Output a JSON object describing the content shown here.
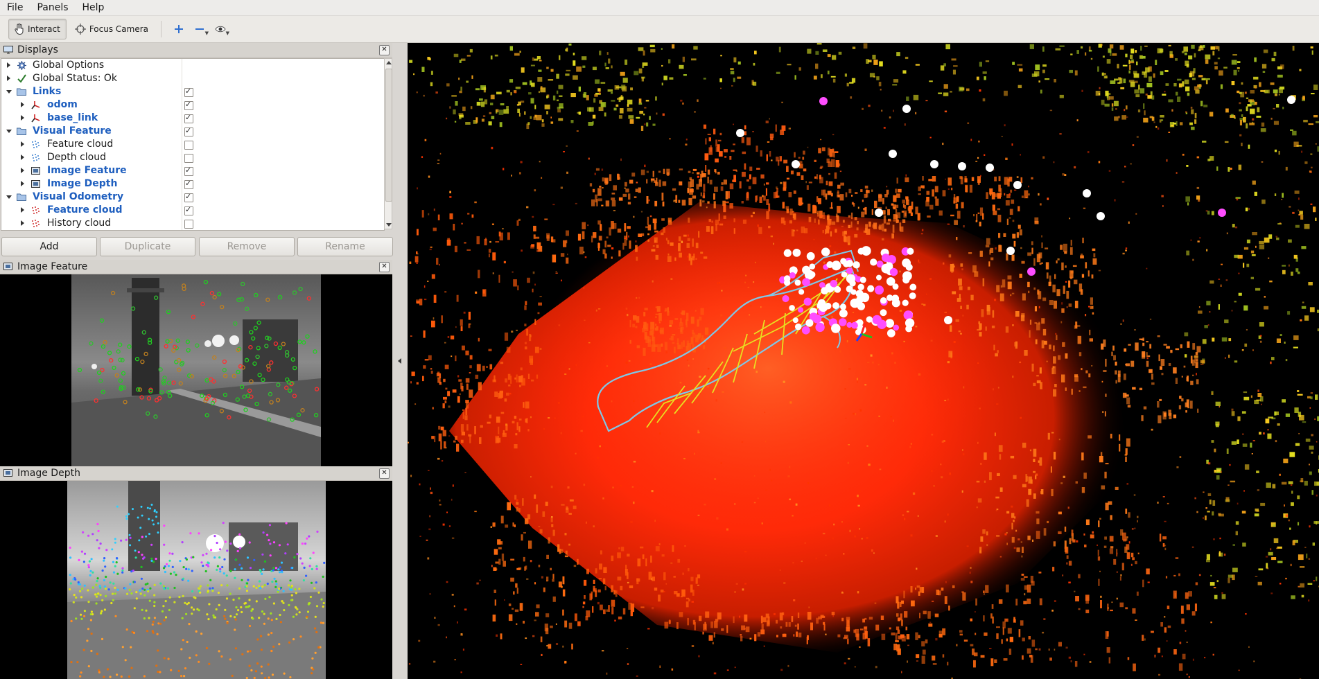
{
  "menu": {
    "items": [
      {
        "label": "File"
      },
      {
        "label": "Panels"
      },
      {
        "label": "Help"
      }
    ]
  },
  "toolbar": {
    "interact_label": "Interact",
    "focus_camera_label": "Focus Camera"
  },
  "displays": {
    "title": "Displays",
    "tree": [
      {
        "label": "Global Options"
      },
      {
        "label": "Global Status: Ok"
      },
      {
        "label": "Links",
        "checked": true
      },
      {
        "label": "odom",
        "checked": true
      },
      {
        "label": "base_link",
        "checked": true
      },
      {
        "label": "Visual Feature",
        "checked": true
      },
      {
        "label": "Feature cloud",
        "checked": false
      },
      {
        "label": "Depth cloud",
        "checked": false
      },
      {
        "label": "Image Feature",
        "checked": true
      },
      {
        "label": "Image Depth",
        "checked": true
      },
      {
        "label": "Visual Odometry",
        "checked": true
      },
      {
        "label": "Feature cloud",
        "checked": true
      },
      {
        "label": "History cloud",
        "checked": false
      }
    ],
    "buttons": {
      "add": "Add",
      "duplicate": "Duplicate",
      "remove": "Remove",
      "rename": "Rename"
    }
  },
  "image_feature": {
    "title": "Image Feature"
  },
  "image_depth": {
    "title": "Image Depth"
  },
  "colors": {
    "link_blue": "#1f5fbf",
    "point_cloud_red": "#ff3300",
    "point_cloud_orange": "#ff7a10",
    "point_cloud_yellow": "#e6e020",
    "trajectory": "#7fc8e8",
    "feature_magenta": "#ff4dff"
  }
}
